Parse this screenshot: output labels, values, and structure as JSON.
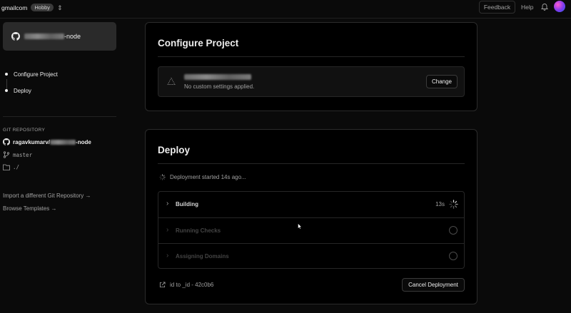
{
  "topbar": {
    "team_name": "gmailcom",
    "plan_badge": "Hobby",
    "feedback_label": "Feedback",
    "help_label": "Help"
  },
  "sidebar": {
    "repo_card": {
      "name_suffix": "-node",
      "icon": "github-icon"
    },
    "steps": [
      {
        "label": "Configure Project"
      },
      {
        "label": "Deploy"
      }
    ],
    "git": {
      "heading": "GIT REPOSITORY",
      "owner": "ragavkumarv/",
      "repo_suffix": "-node",
      "branch": "master",
      "root_dir": "./"
    },
    "links": {
      "import_label": "Import a different Git Repository →",
      "browse_label": "Browse Templates →"
    }
  },
  "configure": {
    "title": "Configure Project",
    "settings_sub": "No custom settings applied.",
    "change_label": "Change"
  },
  "deploy": {
    "title": "Deploy",
    "status_text": "Deployment started 14s ago...",
    "steps": [
      {
        "label": "Building",
        "time": "13s",
        "state": "in-progress"
      },
      {
        "label": "Running Checks",
        "state": "pending"
      },
      {
        "label": "Assigning Domains",
        "state": "pending"
      }
    ],
    "id_text": "id to _id - 42c0b6",
    "cancel_label": "Cancel Deployment"
  },
  "colors": {
    "background": "#0a0a0a",
    "panel": "#000000",
    "text": "#ededed",
    "muted": "#a1a1a1"
  }
}
